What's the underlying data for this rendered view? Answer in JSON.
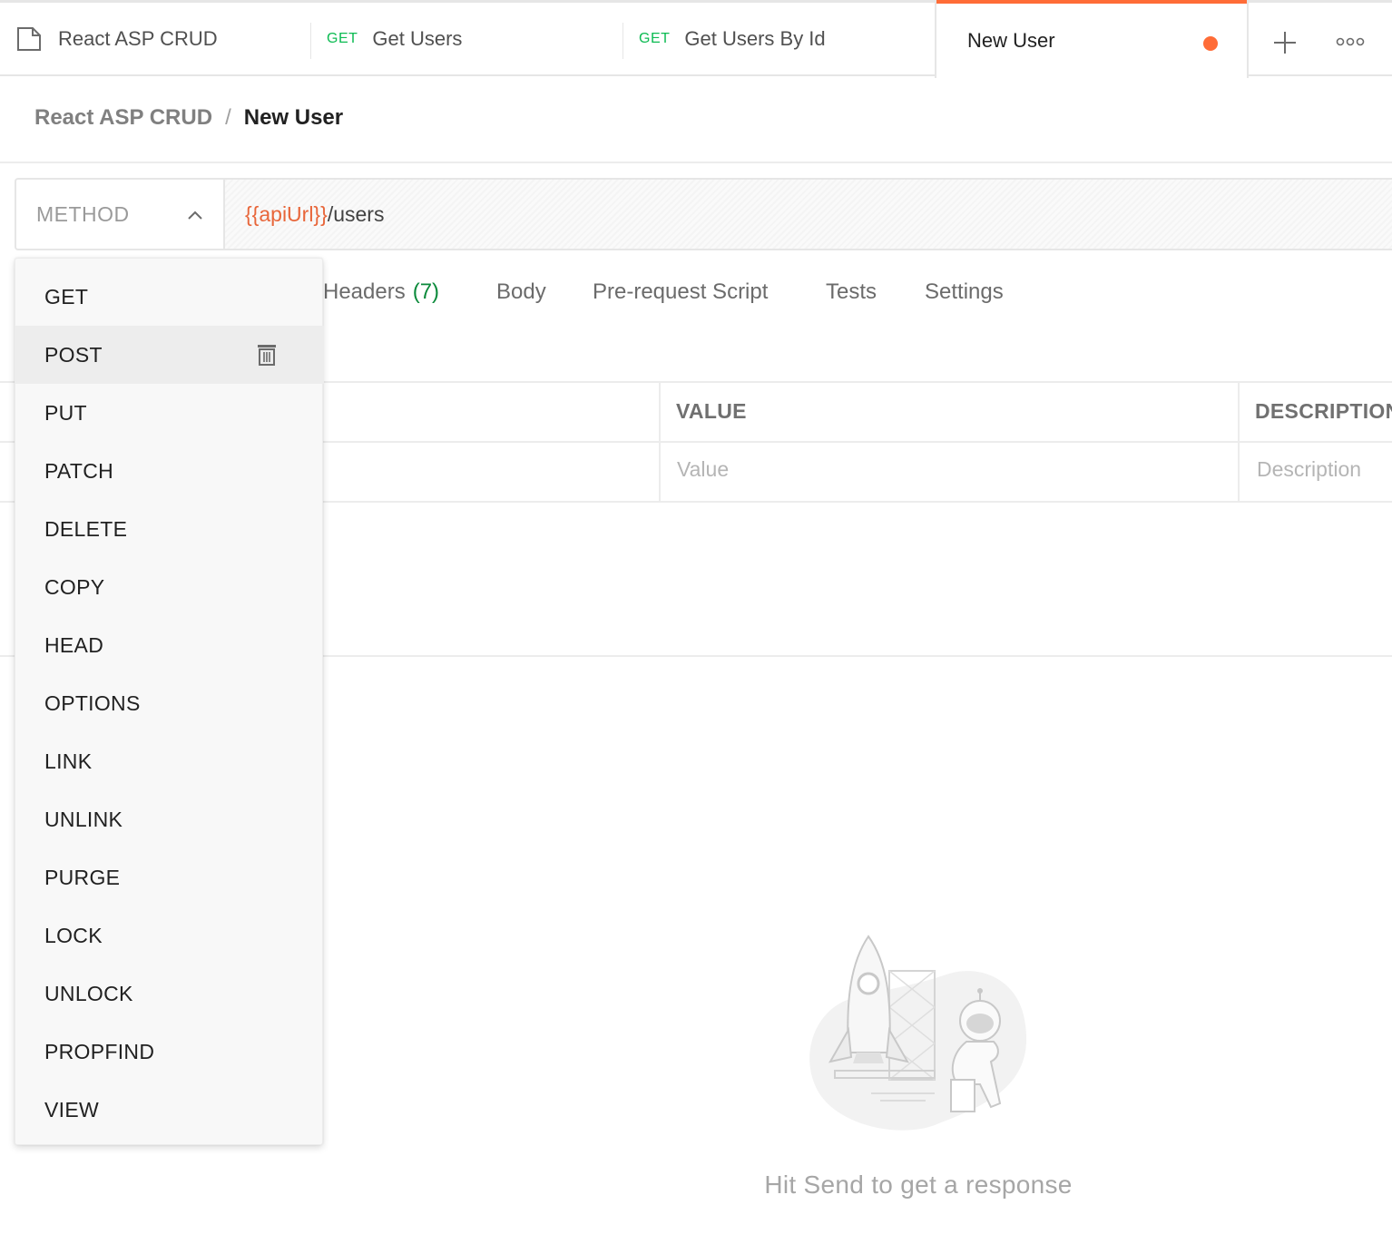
{
  "tabs": [
    {
      "method": "",
      "label": "React ASP CRUD",
      "icon": "collection-icon"
    },
    {
      "method": "GET",
      "label": "Get Users"
    },
    {
      "method": "GET",
      "label": "Get Users By Id"
    },
    {
      "method": "",
      "label": "New User",
      "active": true,
      "unsaved": true
    }
  ],
  "tab_actions": {
    "new_tab_icon": "plus-icon",
    "more_icon": "more-options-icon"
  },
  "breadcrumb": {
    "parent": "React ASP CRUD",
    "separator": "/",
    "current": "New User"
  },
  "request": {
    "method_placeholder": "METHOD",
    "url_variable": "{{apiUrl}}",
    "url_path": "/users"
  },
  "request_tabs": [
    {
      "label": "Headers",
      "count": "(7)"
    },
    {
      "label": "Body"
    },
    {
      "label": "Pre-request Script"
    },
    {
      "label": "Tests"
    },
    {
      "label": "Settings"
    }
  ],
  "params_table": {
    "headers": [
      "VALUE",
      "DESCRIPTION"
    ],
    "row_placeholders": [
      "Value",
      "Description"
    ]
  },
  "method_dropdown": {
    "items": [
      "GET",
      "POST",
      "PUT",
      "PATCH",
      "DELETE",
      "COPY",
      "HEAD",
      "OPTIONS",
      "LINK",
      "UNLINK",
      "PURGE",
      "LOCK",
      "UNLOCK",
      "PROPFIND",
      "VIEW"
    ],
    "hovered": "POST"
  },
  "response": {
    "empty_message": "Hit Send to get a response"
  },
  "colors": {
    "accent": "#ff6c37",
    "get": "#0cbb52",
    "variable": "#e8663a",
    "count": "#0b8a3b"
  }
}
